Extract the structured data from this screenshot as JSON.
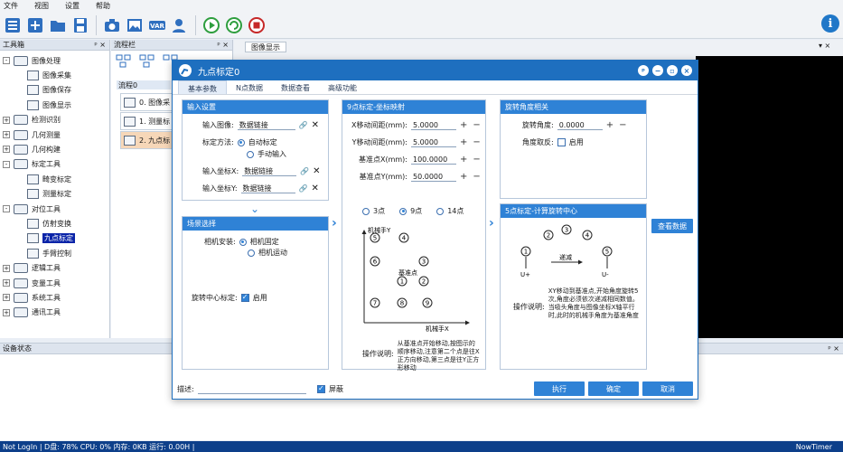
{
  "menu": [
    "文件",
    "视图",
    "设置",
    "帮助"
  ],
  "panels": {
    "toolbox_title": "工具箱",
    "flow_title": "流程栏",
    "image_tab": "图像显示",
    "device_title": "设备状态",
    "pin": "ᵖ",
    "close": "×"
  },
  "tree": [
    {
      "label": "图像处理",
      "level": 0,
      "exp": "-"
    },
    {
      "label": "图像采集",
      "level": 1
    },
    {
      "label": "图像保存",
      "level": 1
    },
    {
      "label": "图像显示",
      "level": 1
    },
    {
      "label": "检测识别",
      "level": 0,
      "exp": "+"
    },
    {
      "label": "几何测量",
      "level": 0,
      "exp": "+"
    },
    {
      "label": "几何构建",
      "level": 0,
      "exp": "+"
    },
    {
      "label": "标定工具",
      "level": 0,
      "exp": "-"
    },
    {
      "label": "畸变标定",
      "level": 1
    },
    {
      "label": "测量标定",
      "level": 1
    },
    {
      "label": "对位工具",
      "level": 0,
      "exp": "-"
    },
    {
      "label": "仿射变换",
      "level": 1
    },
    {
      "label": "九点标定",
      "level": 1,
      "selected": true
    },
    {
      "label": "手臂控制",
      "level": 1
    },
    {
      "label": "逻辑工具",
      "level": 0,
      "exp": "+"
    },
    {
      "label": "变量工具",
      "level": 0,
      "exp": "+"
    },
    {
      "label": "系统工具",
      "level": 0,
      "exp": "+"
    },
    {
      "label": "通讯工具",
      "level": 0,
      "exp": "+"
    }
  ],
  "flow": {
    "tab": "流程0",
    "items": [
      "0. 图像采",
      "1. 测量标",
      "2. 九点标"
    ]
  },
  "dialog": {
    "title": "九点标定0",
    "tabs": [
      "基本参数",
      "N点数据",
      "数据查看",
      "高级功能"
    ],
    "input": {
      "head": "输入设置",
      "image_label": "输入图像:",
      "image_value": "数据链接",
      "method_label": "标定方法:",
      "method_auto": "自动标定",
      "method_manual": "手动输入",
      "x_label": "输入坐标X:",
      "x_value": "数据链接",
      "y_label": "输入坐标Y:",
      "y_value": "数据链接"
    },
    "scene": {
      "head": "场景选择",
      "cam_label": "相机安装:",
      "cam_fixed": "相机固定",
      "cam_move": "相机运动",
      "rot_label": "旋转中心标定:",
      "rot_enable": "启用"
    },
    "nine": {
      "head": "9点标定-坐标映射",
      "xstep_label": "X移动间距(mm):",
      "xstep": "5.0000",
      "ystep_label": "Y移动间距(mm):",
      "ystep": "5.0000",
      "basex_label": "基准点X(mm):",
      "basex": "100.0000",
      "basey_label": "基准点Y(mm):",
      "basey": "50.0000",
      "opt3": "3点",
      "opt9": "9点",
      "opt14": "14点",
      "axis_y": "机械手Y",
      "axis_x": "机械手X",
      "base": "基准点",
      "nodes": [
        "1",
        "2",
        "3",
        "4",
        "5",
        "6",
        "7",
        "8",
        "9"
      ],
      "op_label": "操作说明:",
      "op_text": "从基准点开始移动,按图示的顺序移动,注意第二个点是往X正方向移动,第三点是往Y正方形移动"
    },
    "rot": {
      "head": "旋转角度相关",
      "angle_label": "旋转角度:",
      "angle": "0.0000",
      "invert_label": "角度取反:",
      "invert": "启用"
    },
    "five": {
      "head": "5点标定-计算旋转中心",
      "nodes": [
        "1",
        "2",
        "3",
        "4",
        "5"
      ],
      "inc": "递减",
      "uplus": "U+",
      "uminus": "U-",
      "op_label": "操作说明:",
      "op_text": "XY移动到基准点,开始角度旋转5次,角度必须依次递减相同数值。当吸头角度与图像坐标X轴平行时,此时的机械手角度为基准角度"
    },
    "view_data": "查看数据",
    "desc_label": "描述:",
    "shield": "屏蔽",
    "run": "执行",
    "ok": "确定",
    "cancel": "取消"
  },
  "status": {
    "text": "Not LogIn | D盘: 78% CPU: 0% 内存: 0KB 运行: 0.00H |",
    "right": "NowTimer"
  }
}
